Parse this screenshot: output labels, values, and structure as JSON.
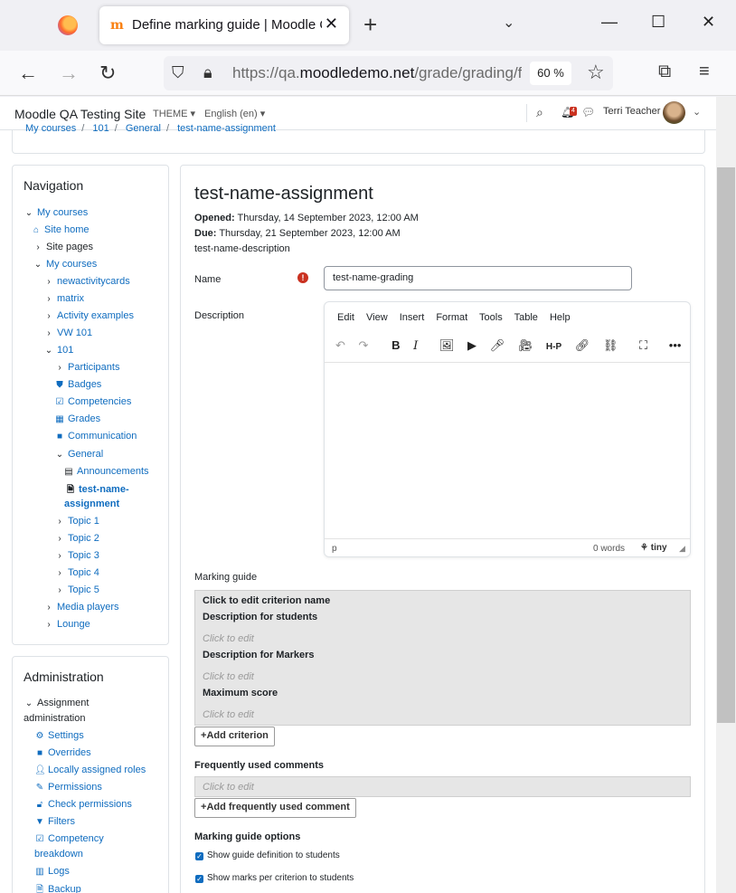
{
  "browser": {
    "tab_title": "Define marking guide | Moodle QA Testing Site",
    "tab_close": "✕",
    "new_tab": "+",
    "url_prefix": "https://qa.",
    "url_domain": "moodledemo.net",
    "url_rest": "/grade/grading/form/guide/edit.php",
    "zoom": "60 %"
  },
  "header": {
    "site_name": "Moodle QA Testing Site",
    "theme_label": "THEME ▾",
    "language": "English (en) ▾",
    "notification_count": "4",
    "user_name": "Terri Teacher"
  },
  "breadcrumb": [
    "My courses",
    "101",
    "General",
    "test-name-assignment"
  ],
  "navigation": {
    "title": "Navigation",
    "items": [
      {
        "label": "My courses",
        "icon": "chevron-down-icon",
        "link": true
      },
      {
        "label": "Site home",
        "icon": "home-icon",
        "link": true
      },
      {
        "label": "Site pages",
        "icon": "chevron-right-icon",
        "link": false
      },
      {
        "label": "My courses",
        "icon": "chevron-down-icon",
        "link": true
      },
      {
        "label": "newactivitycards",
        "icon": "chevron-right-icon",
        "link": true
      },
      {
        "label": "matrix",
        "icon": "chevron-right-icon",
        "link": true
      },
      {
        "label": "Activity examples",
        "icon": "chevron-right-icon",
        "link": true
      },
      {
        "label": "VW 101",
        "icon": "chevron-right-icon",
        "link": true
      },
      {
        "label": "101",
        "icon": "chevron-down-icon",
        "link": true
      },
      {
        "label": "Participants",
        "icon": "chevron-right-icon",
        "link": true
      },
      {
        "label": "Badges",
        "icon": "shield-icon",
        "link": true
      },
      {
        "label": "Competencies",
        "icon": "checkbox-icon",
        "link": true
      },
      {
        "label": "Grades",
        "icon": "table-icon",
        "link": true
      },
      {
        "label": "Communication",
        "icon": "square-icon",
        "link": true
      },
      {
        "label": "General",
        "icon": "chevron-down-icon",
        "link": true
      },
      {
        "label": "Announcements",
        "icon": "forum-icon",
        "link": true
      },
      {
        "label": "test-name-",
        "icon": "assignment-icon",
        "link": true
      },
      {
        "label": "assignment",
        "icon": "",
        "link": true
      },
      {
        "label": "Topic 1",
        "icon": "chevron-right-icon",
        "link": true
      },
      {
        "label": "Topic 2",
        "icon": "chevron-right-icon",
        "link": true
      },
      {
        "label": "Topic 3",
        "icon": "chevron-right-icon",
        "link": true
      },
      {
        "label": "Topic 4",
        "icon": "chevron-right-icon",
        "link": true
      },
      {
        "label": "Topic 5",
        "icon": "chevron-right-icon",
        "link": true
      },
      {
        "label": "Media players",
        "icon": "chevron-right-icon",
        "link": true
      },
      {
        "label": "Lounge",
        "icon": "chevron-right-icon",
        "link": true
      }
    ]
  },
  "administration": {
    "title": "Administration",
    "items": [
      {
        "label": "Assignment",
        "icon": "chevron-down-icon",
        "link": false
      },
      {
        "label": "administration",
        "icon": "",
        "link": false
      },
      {
        "label": "Settings",
        "icon": "gear-icon",
        "link": true
      },
      {
        "label": "Overrides",
        "icon": "square-icon",
        "link": true
      },
      {
        "label": "Locally assigned roles",
        "icon": "user-icon",
        "link": true
      },
      {
        "label": "Permissions",
        "icon": "pencil-icon",
        "link": true
      },
      {
        "label": "Check permissions",
        "icon": "unlock-icon",
        "link": true
      },
      {
        "label": "Filters",
        "icon": "filter-icon",
        "link": true
      },
      {
        "label": "Competency",
        "icon": "checkbox-icon",
        "link": true
      },
      {
        "label": "breakdown",
        "icon": "",
        "link": true
      },
      {
        "label": "Logs",
        "icon": "chart-icon",
        "link": true
      },
      {
        "label": "Backup",
        "icon": "file-icon",
        "link": true
      }
    ]
  },
  "main": {
    "title": "test-name-assignment",
    "opened_label": "Opened:",
    "opened_value": "Thursday, 14 September 2023, 12:00 AM",
    "due_label": "Due:",
    "due_value": "Thursday, 21 September 2023, 12:00 AM",
    "description_text": "test-name-description",
    "name_label": "Name",
    "name_value": "test-name-grading",
    "description_label": "Description",
    "editor_menu": [
      "Edit",
      "View",
      "Insert",
      "Format",
      "Tools",
      "Table",
      "Help"
    ],
    "editor_status_path": "p",
    "editor_word_count": "0 words",
    "editor_brand": "tiny",
    "marking_guide_label": "Marking guide",
    "criterion_name": "Click to edit criterion name",
    "desc_students_label": "Description for students",
    "desc_markers_label": "Description for Markers",
    "max_score_label": "Maximum score",
    "click_to_edit": "Click to edit",
    "add_criterion": "Add criterion",
    "fuc_label": "Frequently used comments",
    "add_fuc": "Add frequently used comment",
    "options_label": "Marking guide options",
    "option_1": "Show guide definition to students",
    "option_2": "Show marks per criterion to students"
  }
}
